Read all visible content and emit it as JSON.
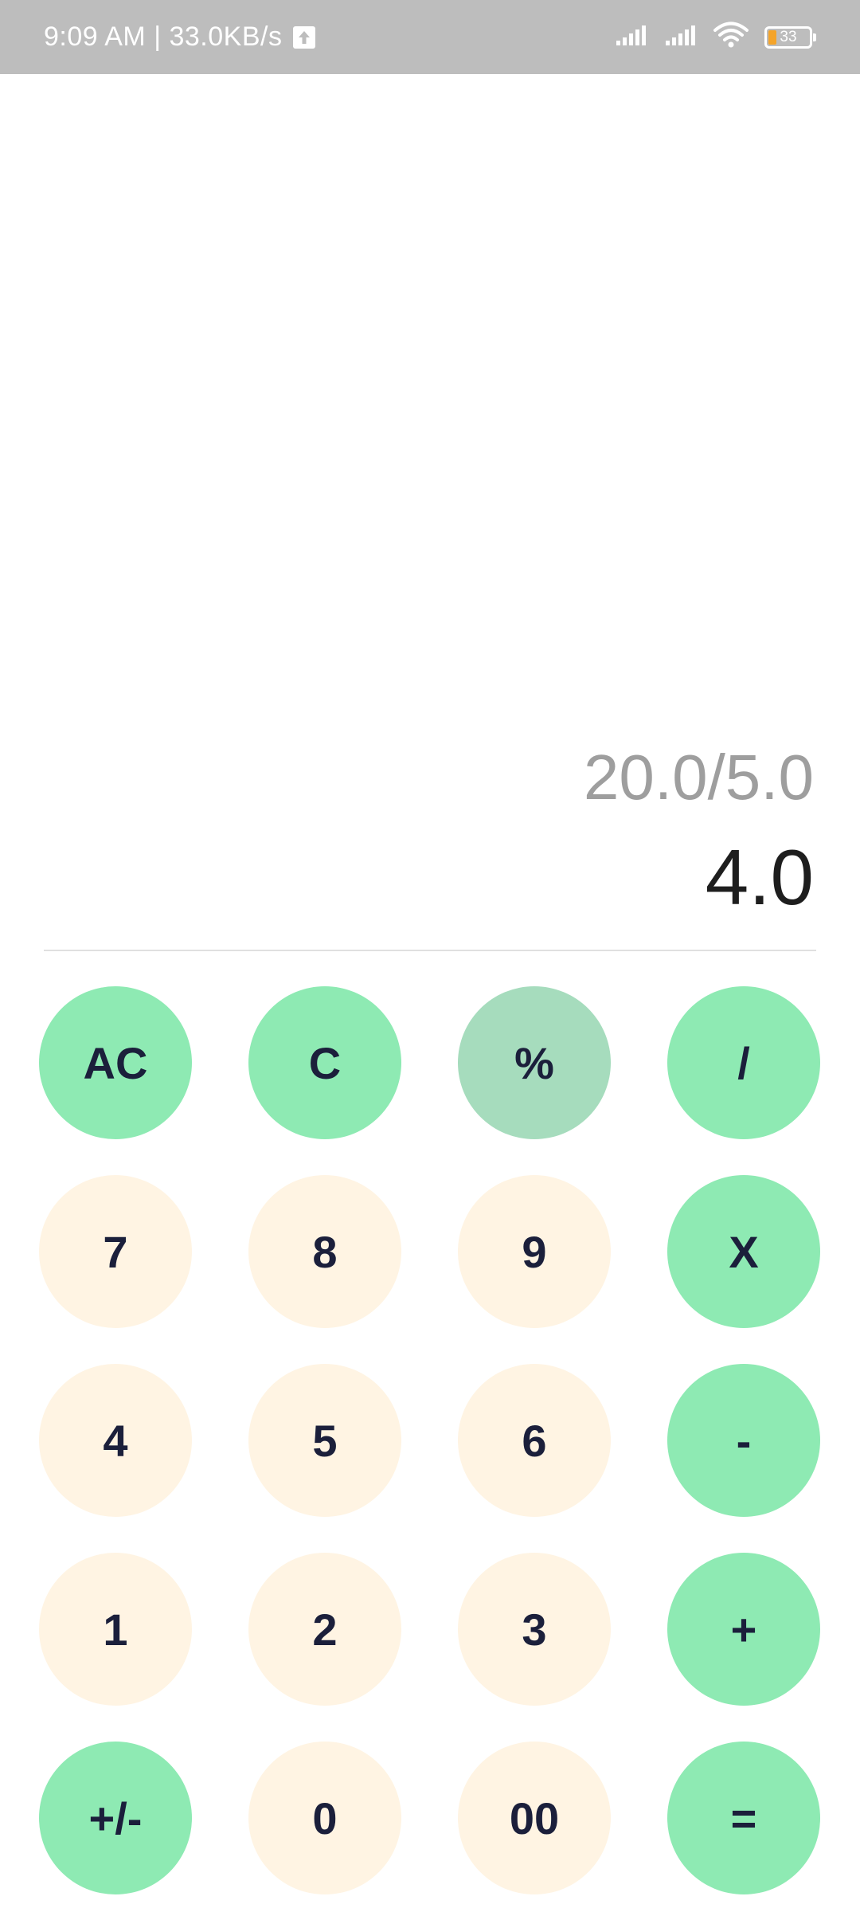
{
  "status_bar": {
    "time_speed": "9:09 AM | 33.0KB/s",
    "battery_level": "33",
    "icons": [
      "upload-icon",
      "signal-icon",
      "signal-icon",
      "wifi-icon",
      "battery-icon"
    ]
  },
  "display": {
    "expression": "20.0/5.0",
    "result": "4.0"
  },
  "keypad": {
    "rows": [
      [
        "AC",
        "C",
        "%",
        "/"
      ],
      [
        "7",
        "8",
        "9",
        "X"
      ],
      [
        "4",
        "5",
        "6",
        "-"
      ],
      [
        "1",
        "2",
        "3",
        "+"
      ],
      [
        "+/-",
        "0",
        "00",
        "="
      ]
    ]
  },
  "colors": {
    "operator_key": "#8eeab3",
    "percent_key": "#a6dcbd",
    "number_key": "#fff4e3",
    "key_text": "#1b1f3b",
    "status_bar": "#bdbdbd"
  }
}
